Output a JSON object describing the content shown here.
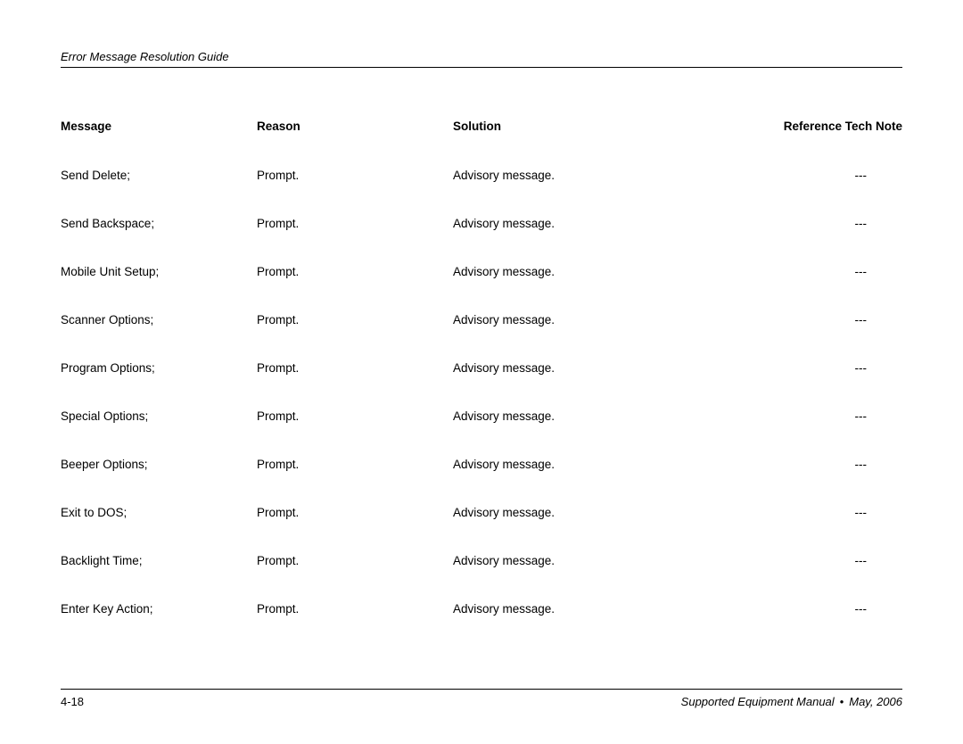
{
  "header": {
    "title": "Error Message Resolution Guide"
  },
  "table": {
    "columns": {
      "message": "Message",
      "reason": "Reason",
      "solution": "Solution",
      "ref": "Reference Tech Note"
    },
    "rows": [
      {
        "message": "Send Delete;",
        "reason": "Prompt.",
        "solution": "Advisory message.",
        "ref": "---"
      },
      {
        "message": "Send Backspace;",
        "reason": "Prompt.",
        "solution": "Advisory message.",
        "ref": "---"
      },
      {
        "message": "Mobile Unit Setup;",
        "reason": "Prompt.",
        "solution": "Advisory message.",
        "ref": "---"
      },
      {
        "message": "Scanner Options;",
        "reason": "Prompt.",
        "solution": "Advisory message.",
        "ref": "---"
      },
      {
        "message": "Program Options;",
        "reason": "Prompt.",
        "solution": "Advisory message.",
        "ref": "---"
      },
      {
        "message": "Special Options;",
        "reason": "Prompt.",
        "solution": "Advisory message.",
        "ref": "---"
      },
      {
        "message": "Beeper Options;",
        "reason": "Prompt.",
        "solution": "Advisory message.",
        "ref": "---"
      },
      {
        "message": "Exit to DOS;",
        "reason": "Prompt.",
        "solution": "Advisory message.",
        "ref": "---"
      },
      {
        "message": "Backlight Time;",
        "reason": "Prompt.",
        "solution": "Advisory message.",
        "ref": "---"
      },
      {
        "message": "Enter Key Action;",
        "reason": "Prompt.",
        "solution": "Advisory message.",
        "ref": "---"
      }
    ]
  },
  "footer": {
    "page": "4-18",
    "manual": "Supported Equipment Manual",
    "date": "May, 2006",
    "bullet": "•"
  }
}
